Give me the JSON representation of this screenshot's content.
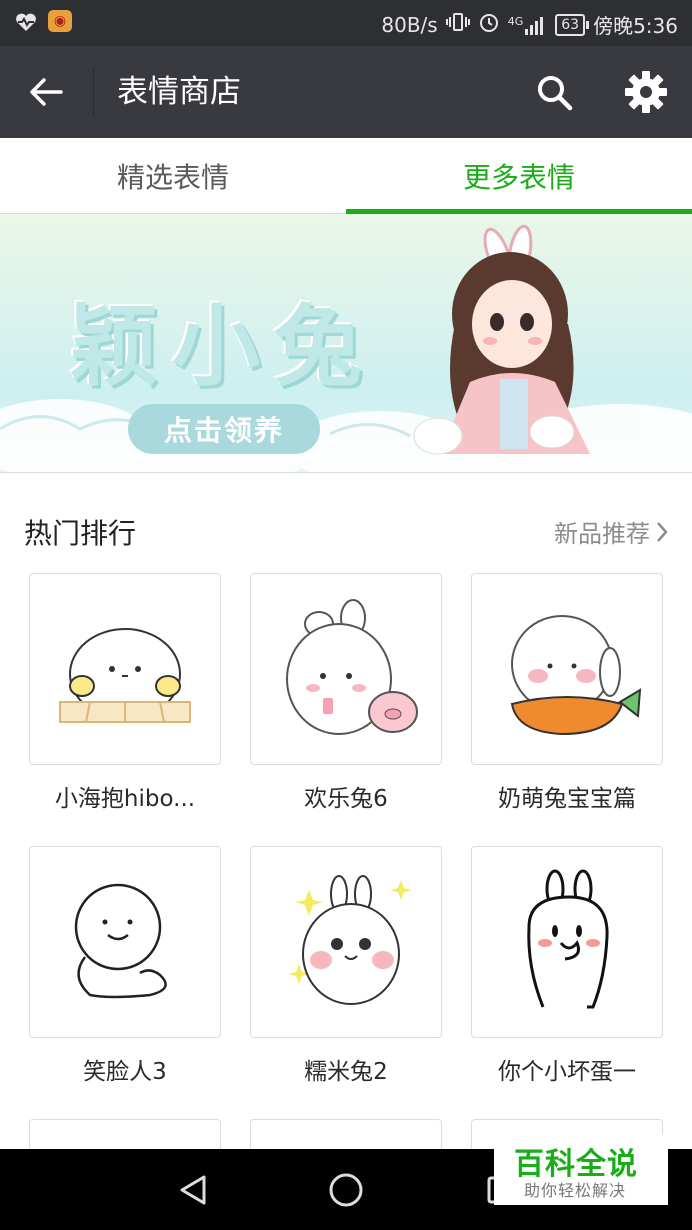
{
  "status_bar": {
    "net_speed": "80B/s",
    "signal": "4G",
    "battery": "63",
    "time": "傍晚5:36",
    "left_icons": [
      "heart-rate-icon",
      "weibo-icon"
    ]
  },
  "header": {
    "title": "表情商店",
    "icons": [
      "back-arrow-icon",
      "search-icon",
      "gear-icon"
    ]
  },
  "tabs": [
    {
      "label": "精选表情",
      "active": false
    },
    {
      "label": "更多表情",
      "active": true
    }
  ],
  "banner": {
    "headline": "颖小兔",
    "cta": "点击领养"
  },
  "section": {
    "title": "热门排行",
    "link": "新品推荐"
  },
  "stickers": [
    {
      "name": "小海抱hibo..."
    },
    {
      "name": "欢乐兔6"
    },
    {
      "name": "奶萌兔宝宝篇"
    },
    {
      "name": "笑脸人3"
    },
    {
      "name": "糯米兔2"
    },
    {
      "name": "你个小坏蛋一"
    }
  ],
  "watermark": {
    "title": "百科全说",
    "subtitle": "助你轻松解决"
  },
  "colors": {
    "accent": "#1aad19",
    "titlebar": "#393a3f",
    "statusbar": "#2e2f33"
  }
}
